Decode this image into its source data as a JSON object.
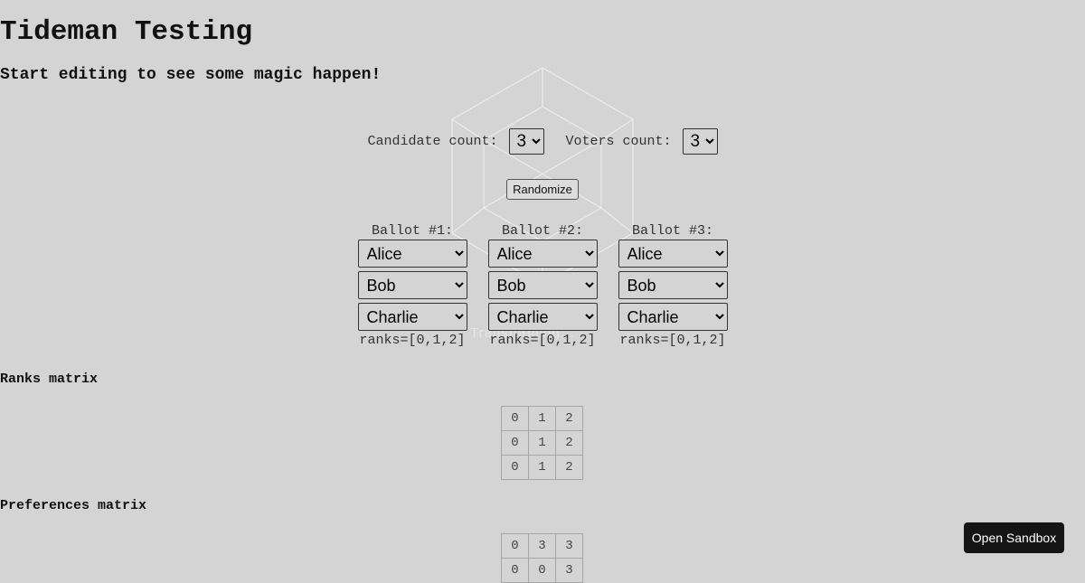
{
  "title": "Tideman Testing",
  "subtitle": "Start editing to see some magic happen!",
  "controls": {
    "candidate_label": "Candidate count:",
    "candidate_value": "3",
    "voters_label": "Voters count:",
    "voters_value": "3",
    "randomize_label": "Randomize"
  },
  "ballots": [
    {
      "title": "Ballot #1:",
      "choices": [
        "Alice",
        "Bob",
        "Charlie"
      ],
      "ranks": "ranks=[0,1,2]"
    },
    {
      "title": "Ballot #2:",
      "choices": [
        "Alice",
        "Bob",
        "Charlie"
      ],
      "ranks": "ranks=[0,1,2]"
    },
    {
      "title": "Ballot #3:",
      "choices": [
        "Alice",
        "Bob",
        "Charlie"
      ],
      "ranks": "ranks=[0,1,2]"
    }
  ],
  "ranks_matrix": {
    "title": "Ranks matrix",
    "rows": [
      [
        "0",
        "1",
        "2"
      ],
      [
        "0",
        "1",
        "2"
      ],
      [
        "0",
        "1",
        "2"
      ]
    ]
  },
  "preferences_matrix": {
    "title": "Preferences matrix",
    "rows": [
      [
        "0",
        "3",
        "3"
      ],
      [
        "0",
        "0",
        "3"
      ]
    ]
  },
  "overlay_text": "Transforming...",
  "sandbox_button": "Open Sandbox"
}
